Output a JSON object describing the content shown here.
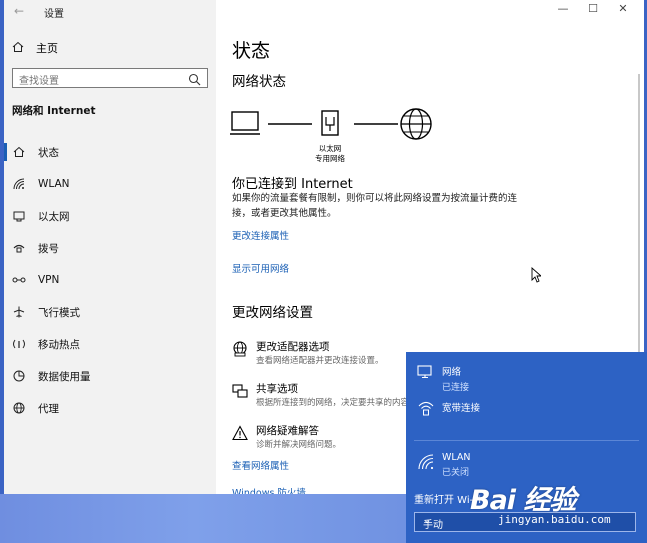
{
  "window": {
    "title": "设置",
    "back_icon": "back-arrow-icon"
  },
  "sidebar": {
    "home_label": "主页",
    "search_placeholder": "查找设置",
    "section_title": "网络和 Internet",
    "items": [
      {
        "label": "状态",
        "icon": "home-status-icon"
      },
      {
        "label": "WLAN",
        "icon": "wifi-icon"
      },
      {
        "label": "以太网",
        "icon": "ethernet-icon"
      },
      {
        "label": "拨号",
        "icon": "dialup-icon"
      },
      {
        "label": "VPN",
        "icon": "vpn-icon"
      },
      {
        "label": "飞行模式",
        "icon": "airplane-icon"
      },
      {
        "label": "移动热点",
        "icon": "hotspot-icon"
      },
      {
        "label": "数据使用量",
        "icon": "data-usage-icon"
      },
      {
        "label": "代理",
        "icon": "globe-icon"
      }
    ]
  },
  "main": {
    "page_title": "状态",
    "network_status_heading": "网络状态",
    "ethernet_label_line1": "以太网",
    "ethernet_label_line2": "专用网络",
    "connected_title": "你已连接到 Internet",
    "connected_desc": "如果你的流量套餐有限制，则你可以将此网络设置为按流量计费的连接，或者更改其他属性。",
    "link_change_props": "更改连接属性",
    "link_show_networks": "显示可用网络",
    "change_settings_heading": "更改网络设置",
    "options": [
      {
        "title": "更改适配器选项",
        "subtitle": "查看网络适配器并更改连接设置。"
      },
      {
        "title": "共享选项",
        "subtitle": "根据所连接到的网络，决定要共享的内容。"
      },
      {
        "title": "网络疑难解答",
        "subtitle": "诊断并解决网络问题。"
      }
    ],
    "link_view_props": "查看网络属性",
    "link_firewall": "Windows 防火墙"
  },
  "flyout": {
    "network_title": "网络",
    "network_status": "已连接",
    "broadband_title": "宽带连接",
    "wlan_title": "WLAN",
    "wlan_status": "已关闭",
    "reopen_label": "重新打开 Wi-Fi",
    "reopen_value": "手动"
  },
  "watermark": {
    "main": "Bai  经验",
    "sub": "jingyan.baidu.com"
  },
  "colors": {
    "accent": "#1a5fb4",
    "flyout_bg": "#2d62c4",
    "sidebar_bg": "#f2f2f2"
  }
}
